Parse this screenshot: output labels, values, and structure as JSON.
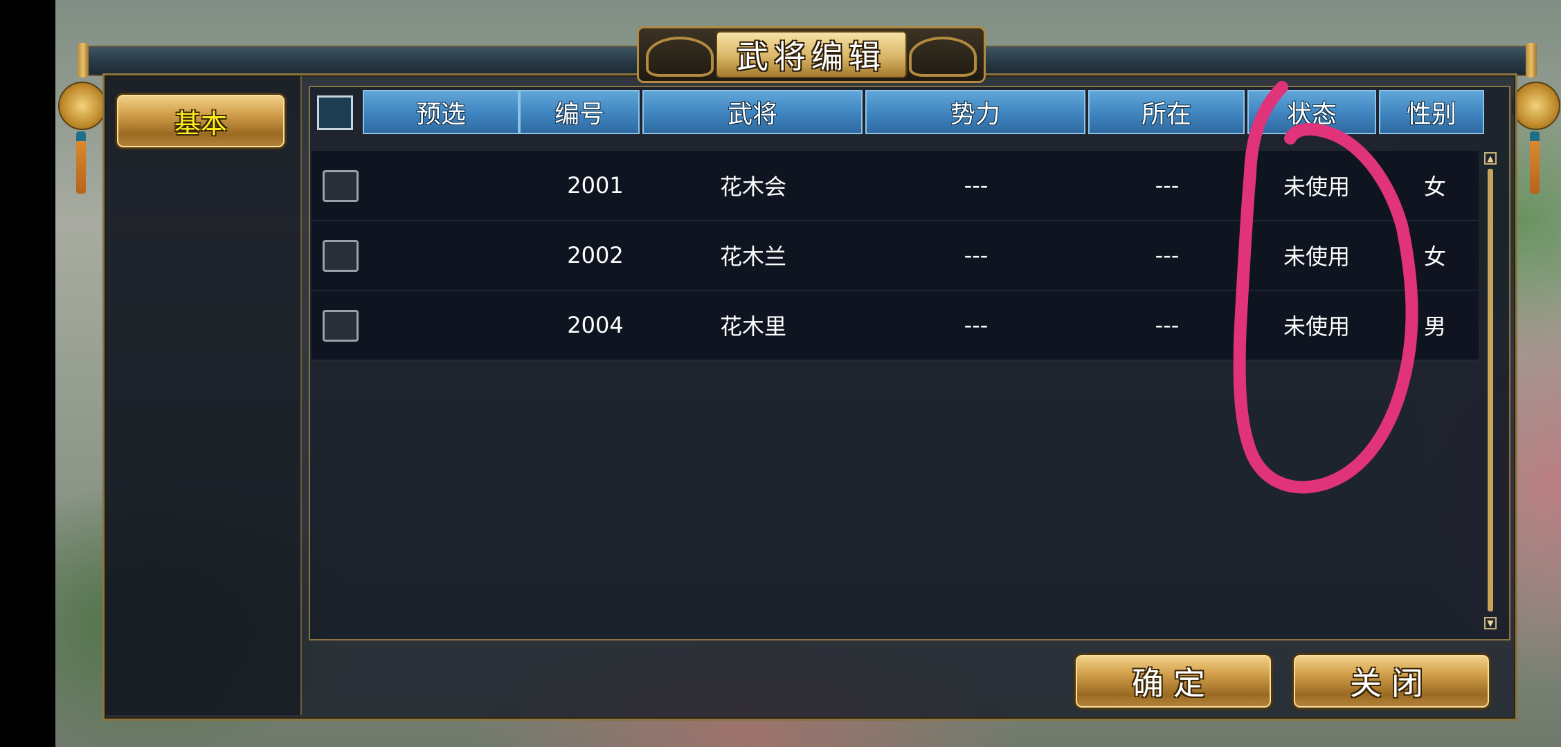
{
  "dialog": {
    "title": "武将编辑"
  },
  "sidebar": {
    "tab_basic": "基本"
  },
  "table": {
    "headers": [
      "预选",
      "编号",
      "武将",
      "势力",
      "所在",
      "状态",
      "性别"
    ],
    "rows": [
      {
        "id": "2001",
        "general": "花木会",
        "faction": "---",
        "location": "---",
        "status": "未使用",
        "gender": "女"
      },
      {
        "id": "2002",
        "general": "花木兰",
        "faction": "---",
        "location": "---",
        "status": "未使用",
        "gender": "女"
      },
      {
        "id": "2004",
        "general": "花木里",
        "faction": "---",
        "location": "---",
        "status": "未使用",
        "gender": "男"
      }
    ]
  },
  "buttons": {
    "confirm": "确定",
    "close": "关闭"
  },
  "annotation": {
    "color": "#e0337a"
  }
}
